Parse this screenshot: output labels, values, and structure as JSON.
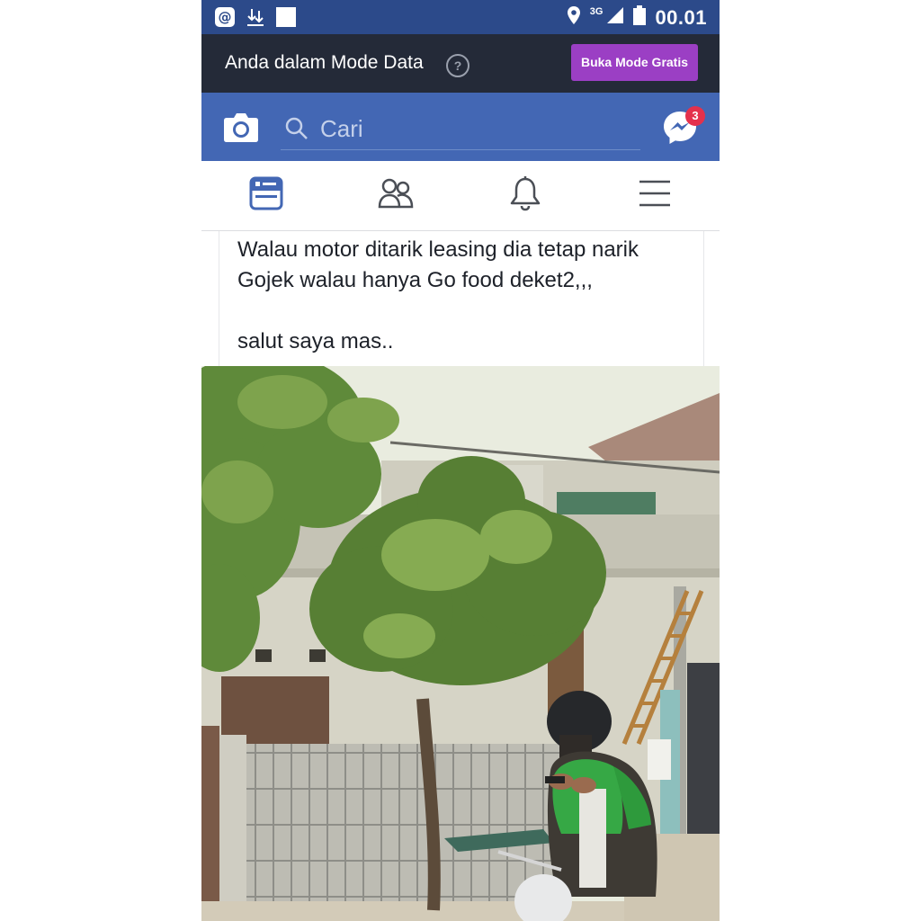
{
  "status_bar": {
    "time": "00.01",
    "network": "3G",
    "icons": [
      "at-sign-icon",
      "download-icon",
      "square-icon",
      "location-pin-icon",
      "signal-icon",
      "battery-icon"
    ]
  },
  "data_mode": {
    "message": "Anda dalam Mode Data",
    "help": "?",
    "button": "Buka Mode Gratis"
  },
  "header": {
    "search_placeholder": "Cari",
    "messenger_badge": "3"
  },
  "tabs": [
    {
      "icon": "news-feed-icon",
      "active": true
    },
    {
      "icon": "friends-icon",
      "active": false
    },
    {
      "icon": "notifications-bell-icon",
      "active": false
    },
    {
      "icon": "menu-icon",
      "active": false
    }
  ],
  "post": {
    "line1": "Walau motor ditarik leasing dia tetap narik",
    "line2": "Gojek walau hanya Go food deket2,,,",
    "line3": "salut saya mas.."
  },
  "colors": {
    "status_bar": "#2c4a8a",
    "data_bar": "#242a38",
    "facebook_blue": "#4367b4",
    "button_purple": "#9b3fc4",
    "badge_red": "#e4314c"
  }
}
